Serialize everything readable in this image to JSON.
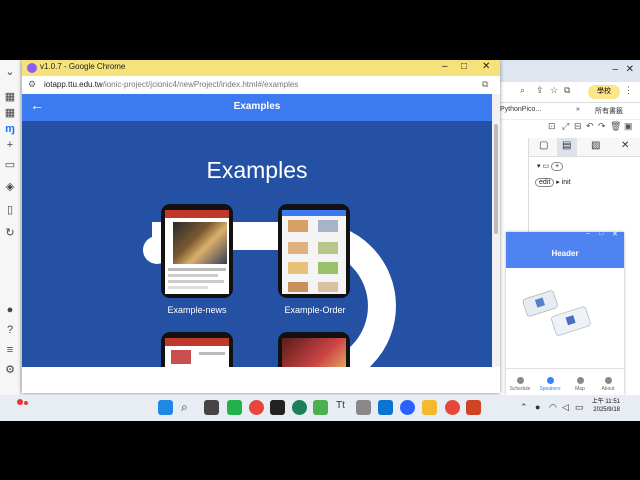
{
  "window": {
    "title": "v1.0.7 - Google Chrome",
    "url_host": "iotapp.ttu.edu.tw",
    "url_path": "/ionic-project/jcionic4/newProject/index.html#/examples",
    "controls": {
      "minimize": "–",
      "restore": "□",
      "close": "✕"
    }
  },
  "app": {
    "header_title": "Examples",
    "back_icon": "arrow-back-icon",
    "page_title": "Examples",
    "examples": [
      {
        "label": "Example-news"
      },
      {
        "label": "Example-Order"
      }
    ],
    "colors": {
      "header": "#3c7bef",
      "content": "#2551a5"
    }
  },
  "editor": {
    "footer_label": "ion-footer",
    "edit_chip": "edit",
    "init_label": "init"
  },
  "background_browser": {
    "profile_chip": "學校",
    "bookmark_1": "PythonPico...",
    "bookmark_2": "所有書籤"
  },
  "preview": {
    "header": "Header",
    "tabs": [
      "Schedule",
      "Speakers",
      "Map",
      "About"
    ],
    "active_tab": "Speakers"
  },
  "taskbar": {
    "time": "上午 11:51",
    "date": "2025/9/18"
  }
}
